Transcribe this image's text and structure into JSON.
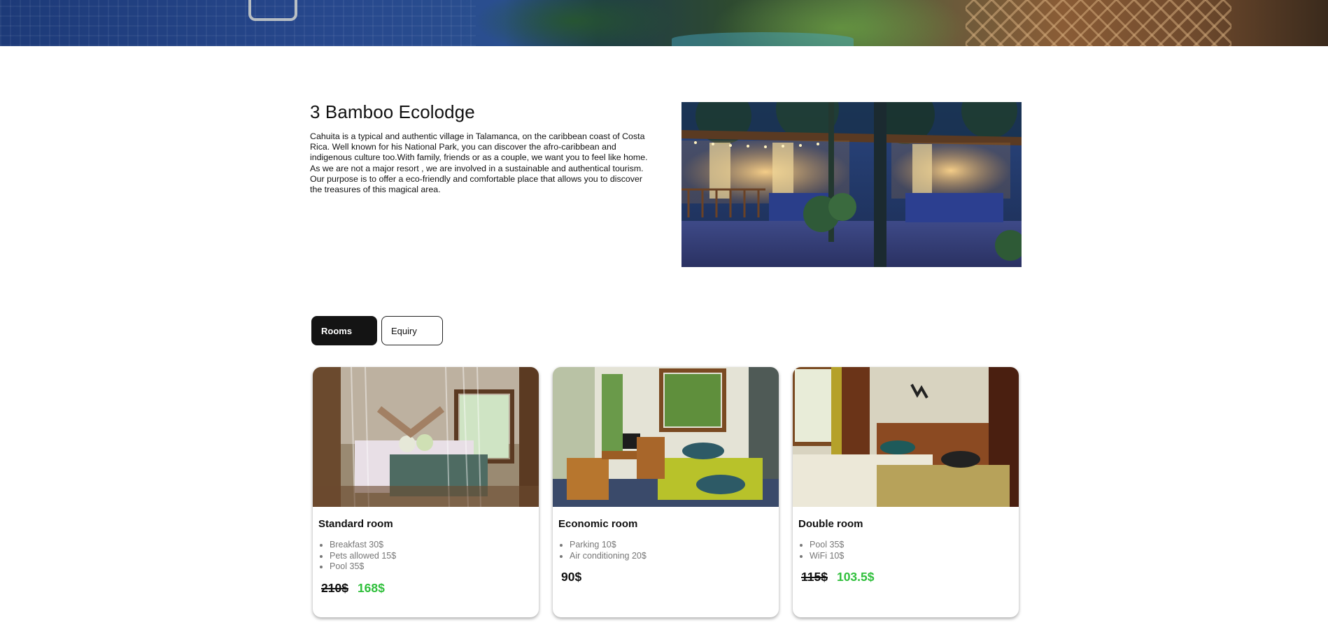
{
  "intro": {
    "title": "3 Bamboo Ecolodge",
    "description": "Cahuita is a typical and authentic village in Talamanca, on the caribbean coast of Costa Rica. Well known for his National Park, you can discover the afro-caribbean and indigenous culture too.With family, friends or as a couple, we want you to feel like home. As we are not a major resort , we are involved in a sustainable and authentical tourism. Our purpose is to offer a eco-friendly and comfortable place that allows you to discover the treasures of this magical area."
  },
  "tabs": [
    {
      "label": "Rooms",
      "active": true
    },
    {
      "label": "Equiry",
      "active": false
    }
  ],
  "rooms": [
    {
      "title": "Standard room",
      "extras": [
        "Breakfast 30$",
        "Pets allowed 15$",
        "Pool 35$"
      ],
      "old_price": "210$",
      "price": "168$"
    },
    {
      "title": "Economic room",
      "extras": [
        "Parking 10$",
        "Air conditioning 20$"
      ],
      "price": "90$"
    },
    {
      "title": "Double room",
      "extras": [
        "Pool 35$",
        "WiFi 10$"
      ],
      "old_price": "115$",
      "price": "103.5$"
    }
  ],
  "colors": {
    "tab_active_bg": "#141414",
    "discount_price": "#2fbf3b",
    "extras_text": "#777777"
  }
}
